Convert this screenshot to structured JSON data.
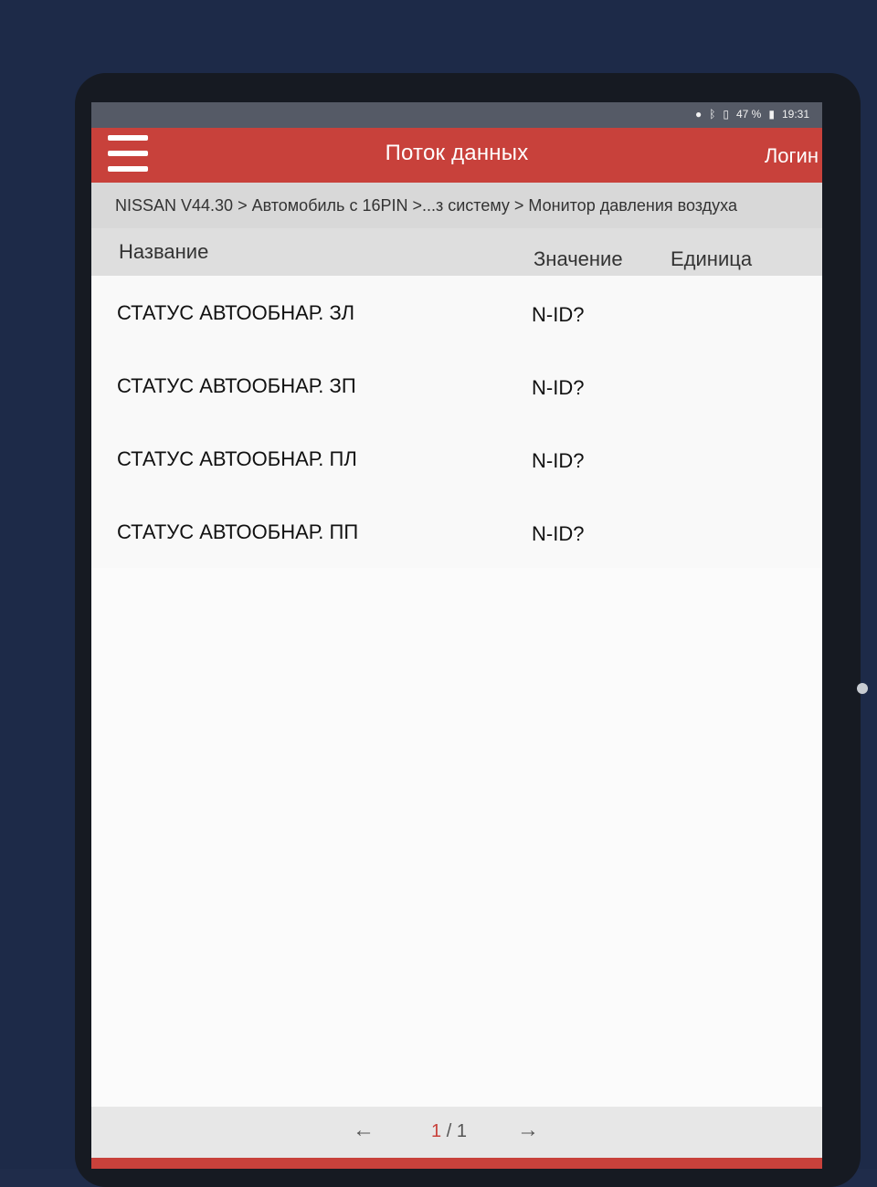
{
  "status_bar": {
    "battery": "47 %",
    "time": "19:31"
  },
  "app_bar": {
    "title": "Поток данных",
    "login": "Логин"
  },
  "breadcrumb": "NISSAN V44.30 > Автомобиль с 16PIN >...з систему > Монитор давления воздуха",
  "table": {
    "headers": {
      "name": "Название",
      "value": "Значение",
      "unit": "Единица"
    },
    "rows": [
      {
        "name": "СТАТУС АВТООБНАР. ЗЛ",
        "value": "N-ID?",
        "unit": ""
      },
      {
        "name": "СТАТУС АВТООБНАР. ЗП",
        "value": "N-ID?",
        "unit": ""
      },
      {
        "name": "СТАТУС АВТООБНАР. ПЛ",
        "value": "N-ID?",
        "unit": ""
      },
      {
        "name": "СТАТУС АВТООБНАР. ПП",
        "value": "N-ID?",
        "unit": ""
      }
    ]
  },
  "pager": {
    "prev_icon": "arrow-left-icon",
    "next_icon": "arrow-right-icon",
    "current": "1",
    "separator": "/",
    "total": "1"
  },
  "colors": {
    "accent": "#c8413b",
    "device_case": "#1d2a48"
  }
}
